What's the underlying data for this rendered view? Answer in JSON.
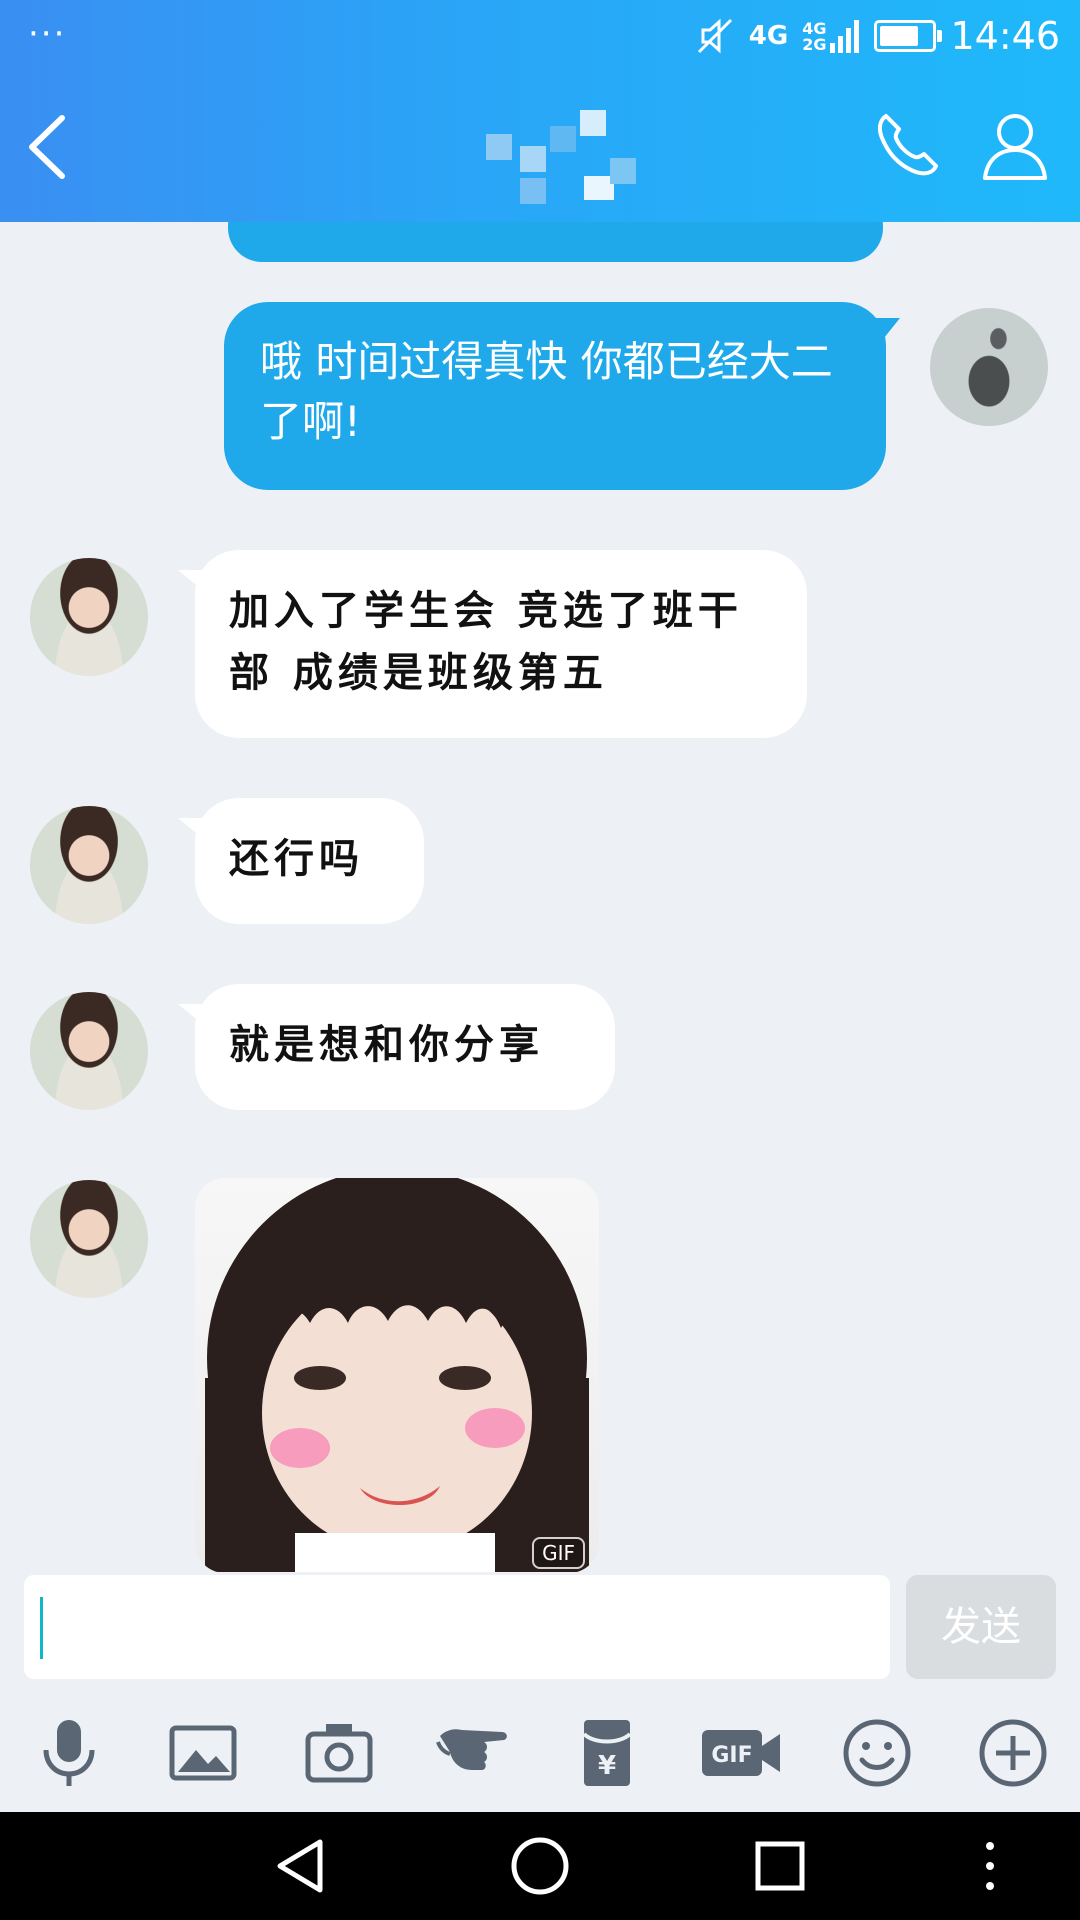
{
  "status_bar": {
    "notification_dots": "···",
    "network_primary": "4G",
    "network_secondary_top": "4G",
    "network_secondary_bottom": "2G",
    "battery_level": 0.75,
    "time": "14:46",
    "icons": [
      "mute-icon",
      "signal-icon",
      "battery-icon"
    ]
  },
  "header": {
    "contact_name": "",
    "back_icon": "chevron-left-icon",
    "call_icon": "phone-icon",
    "profile_icon": "person-icon",
    "colors": {
      "start": "#3a8ff2",
      "end": "#1fb9fa"
    }
  },
  "messages": [
    {
      "side": "out",
      "text": "哦 时间过得真快 你都已经大二了啊!",
      "avatar": "rabbit-avatar"
    },
    {
      "side": "in",
      "text": "加入了学生会 竞选了班干部  成绩是班级第五",
      "avatar": "girl-avatar"
    },
    {
      "side": "in",
      "text": "还行吗",
      "avatar": "girl-avatar"
    },
    {
      "side": "in",
      "text": "就是想和你分享",
      "avatar": "girl-avatar"
    },
    {
      "side": "in",
      "type": "sticker",
      "badge": "GIF",
      "avatar": "girl-avatar"
    }
  ],
  "input": {
    "value": "",
    "send_label": "发送"
  },
  "toolbar": {
    "items": [
      "microphone-icon",
      "image-icon",
      "camera-icon",
      "poke-hand-icon",
      "red-packet-icon",
      "gif-video-icon",
      "emoji-icon",
      "add-icon"
    ],
    "gif_label": "GIF",
    "yen_label": "¥"
  },
  "navbar": {
    "items": [
      "back-triangle-icon",
      "home-circle-icon",
      "recents-square-icon",
      "more-dots-icon"
    ]
  },
  "colors": {
    "bubble_out": "#1fa9ea",
    "bubble_in": "#ffffff",
    "background": "#edf1f6",
    "send_disabled": "#d9dde0"
  }
}
